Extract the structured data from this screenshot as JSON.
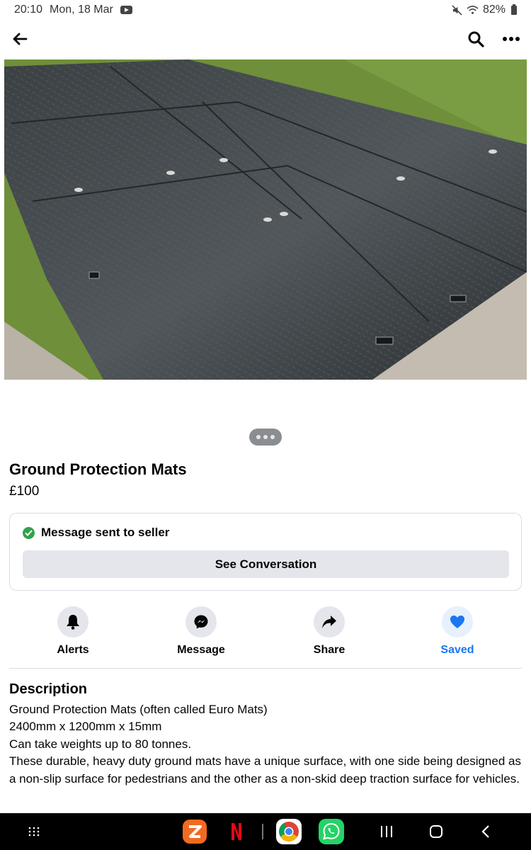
{
  "status_bar": {
    "time": "20:10",
    "date": "Mon, 18 Mar",
    "battery": "82%",
    "icons": [
      "youtube-icon",
      "mute-icon",
      "wifi-icon",
      "battery-icon"
    ]
  },
  "app_bar": {
    "icons": [
      "back-arrow-icon",
      "search-icon",
      "more-options-icon"
    ]
  },
  "listing": {
    "photo_alt": "photo",
    "pager_dots": 3,
    "title": "Ground Protection Mats",
    "price": "£100"
  },
  "message_card": {
    "status_text": "Message sent to seller",
    "button_label": "See Conversation"
  },
  "actions": [
    {
      "label": "Alerts",
      "icon": "bell-icon"
    },
    {
      "label": "Message",
      "icon": "messenger-icon"
    },
    {
      "label": "Share",
      "icon": "share-arrow-icon"
    },
    {
      "label": "Saved",
      "icon": "heart-icon"
    }
  ],
  "description": {
    "heading": "Description",
    "lines": [
      "Ground Protection Mats (often called Euro Mats)",
      "2400mm x 1200mm x 15mm",
      "Can take weights up to 80 tonnes.",
      "These durable, heavy duty ground mats have a unique surface, with one side being designed as a non-slip surface for pedestrians and the other as a non-skid deep traction surface for vehicles."
    ]
  },
  "nav_bar": {
    "items": [
      "apps-grid-icon",
      "app-z-icon",
      "netflix-icon",
      "chrome-icon",
      "whatsapp-icon",
      "recents-icon",
      "home-icon",
      "back-icon"
    ]
  },
  "colors": {
    "accent": "#1877f2",
    "success": "#31a24c",
    "button_bg": "#e4e6eb",
    "text": "#050505"
  }
}
